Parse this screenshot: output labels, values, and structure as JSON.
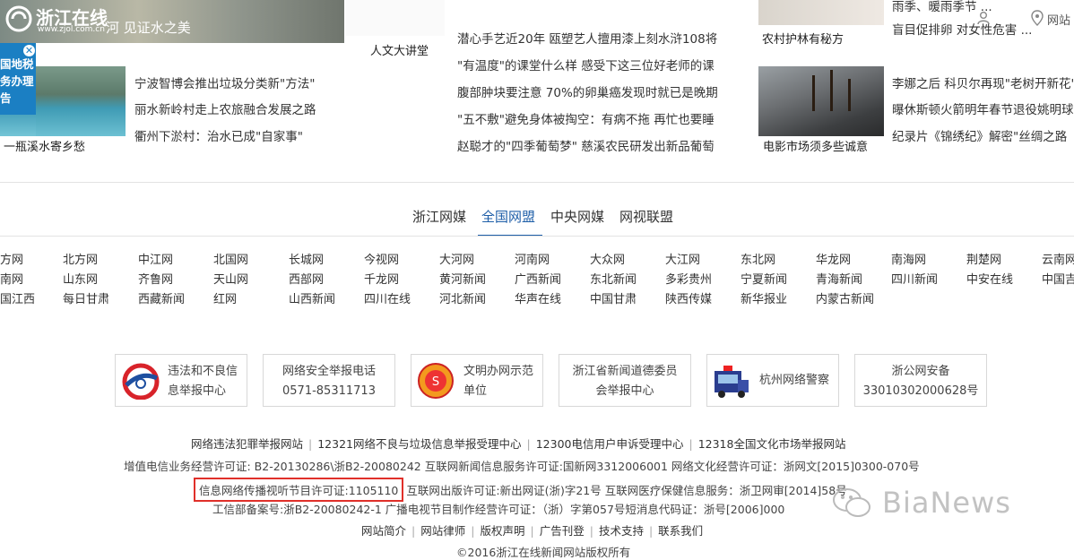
{
  "header": {
    "logo_text": "浙江在线",
    "logo_url": "www.zjol.com.cn",
    "banner_caption": "河 见证水之美"
  },
  "ad": {
    "lines": [
      "国地税",
      "务办理",
      "告"
    ]
  },
  "col1": {
    "photo_caption": "一瓶溪水寄乡愁",
    "items": [
      "宁波智博会推出垃圾分类新\"方法\"",
      "丽水新岭村走上农旅融合发展之路",
      "衢州下淤村：治水已成\"自家事\""
    ]
  },
  "col2": {
    "caption": "人文大讲堂"
  },
  "col3": {
    "items": [
      "潜心手艺近20年 瓯塑艺人擅用漆上刻水浒108将",
      "\"有温度\"的课堂什么样 感受下这三位好老师的课",
      "腹部肿块要注意 70%的卵巢癌发现时就已是晚期",
      "\"五不敷\"避免身体被掏空：有病不拖 再忙也要睡",
      "赵聪才的\"四季葡萄梦\" 慈溪农民研发出新品葡萄"
    ]
  },
  "col4": {
    "top_caption": "农村护林有秘方",
    "photo_caption": "电影市场须多些诚意",
    "items_top": [
      "雨季、暖雨季节 ...",
      "盲目促排卵 对女性危害 ..."
    ],
    "items": [
      "李娜之后 科贝尔再现\"老树开新花\"",
      "曝休斯顿火箭明年春节退役姚明球衣",
      "纪录片《锦绣纪》解密\"丝绸之路"
    ]
  },
  "tabs": [
    "浙江网媒",
    "全国网盟",
    "中央网媒",
    "网视联盟"
  ],
  "media_grid": [
    [
      "方网",
      "北方网",
      "中江网",
      "北国网",
      "长城网",
      "今视网",
      "大河网",
      "河南网",
      "大众网",
      "大江网",
      "东北网",
      "华龙网",
      "南海网",
      "荆楚网",
      "云南网"
    ],
    [
      "南网",
      "山东网",
      "齐鲁网",
      "天山网",
      "西部网",
      "千龙网",
      "黄河新闻",
      "广西新闻",
      "东北新闻",
      "多彩贵州",
      "宁夏新闻",
      "青海新闻",
      "四川新闻",
      "中安在线",
      "中国吉"
    ],
    [
      "国江西",
      "每日甘肃",
      "西藏新闻",
      "红网",
      "山西新闻",
      "四川在线",
      "河北新闻",
      "华声在线",
      "中国甘肃",
      "陕西传媒",
      "新华报业",
      "内蒙古新闻"
    ]
  ],
  "badges": [
    {
      "line1": "违法和不良信",
      "line2": "息举报中心"
    },
    {
      "line1": "网络安全举报电话",
      "line2": "0571-85311713"
    },
    {
      "line1": "文明办网示范",
      "line2": "单位"
    },
    {
      "line1": "浙江省新闻道德委员",
      "line2": "会举报中心"
    },
    {
      "line1": "杭州网络警察",
      "line2": ""
    },
    {
      "line1": "浙公网安备",
      "line2": "33010302000628号"
    }
  ],
  "footer": {
    "report_links": [
      "网络违法犯罪举报网站",
      "12321网络不良与垃圾信息举报受理中心",
      "12300电信用户申诉受理中心",
      "12318全国文化市场举报网站"
    ],
    "license1": "增值电信业务经营许可证: B2-20130286\\浙B2-20080242 互联网新闻信息服务许可证:国新网3312006001 网络文化经营许可证：浙网文[2015]0300-070号",
    "license2_highlight": "信息网络传播视听节目许可证:1105110",
    "license2_rest": "互联网出版许可证:新出网证(浙)字21号 互联网医疗保健信息服务：浙卫网审[2014]58号",
    "license3": "工信部备案号:浙B2-20080242-1 广播电视节目制作经营许可证：（浙）字第057号短消息代码证：浙号[2006]000",
    "nav_links": [
      "网站简介",
      "网站律师",
      "版权声明",
      "广告刊登",
      "技术支持",
      "联系我们"
    ],
    "copyright": "©2016浙江在线新闻网站版权所有"
  },
  "watermark": "BiaNews",
  "colors": {
    "accent": "#1e5ea8",
    "highlight_box": "#e0302a"
  }
}
